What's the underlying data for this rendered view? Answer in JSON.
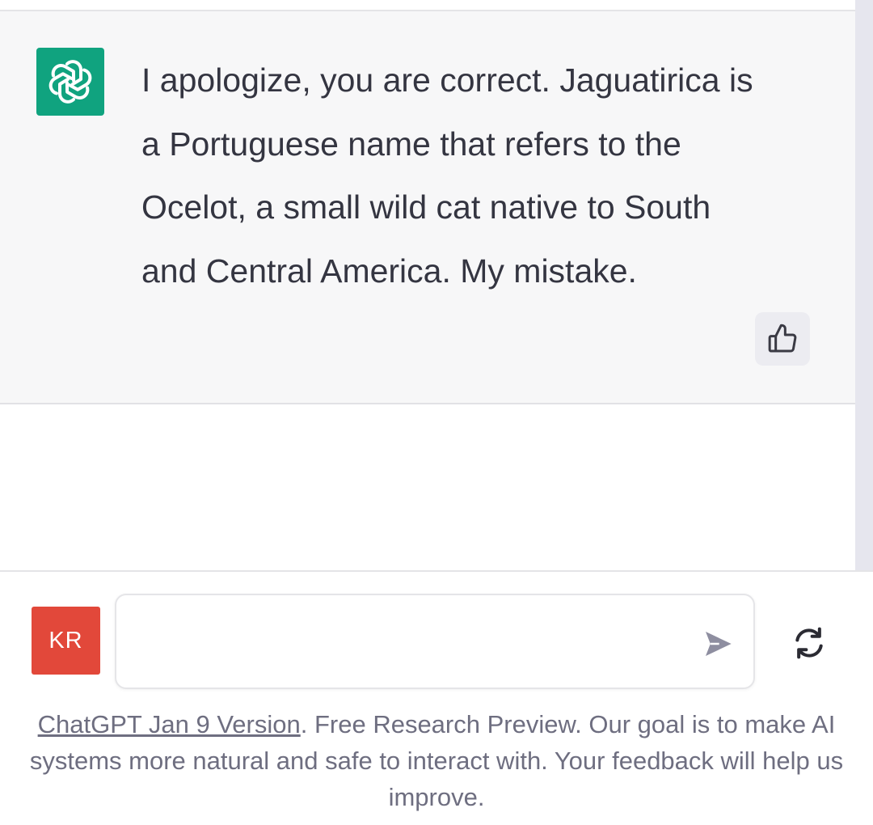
{
  "conversation": {
    "assistant_message": {
      "text": "I apologize, you are correct. Jaguatirica is a Portuguese name that refers to the Ocelot, a small wild cat native to South and Central America. My mistake.",
      "avatar_icon": "openai-logo-icon",
      "feedback_icon": "thumbs-up-icon"
    }
  },
  "composer": {
    "user_initials": "KR",
    "input_value": "",
    "input_placeholder": "",
    "send_icon": "send-icon",
    "regenerate_icon": "refresh-icon"
  },
  "footer": {
    "link_text": "ChatGPT Jan 9 Version",
    "text": ". Free Research Preview. Our goal is to make AI systems more natural and safe to interact with. Your feedback will help us improve."
  },
  "colors": {
    "brand": "#10a37f",
    "user_avatar": "#e2483a",
    "message_bg": "#f7f7f8",
    "text": "#343541",
    "muted_text": "#6e6e80"
  }
}
